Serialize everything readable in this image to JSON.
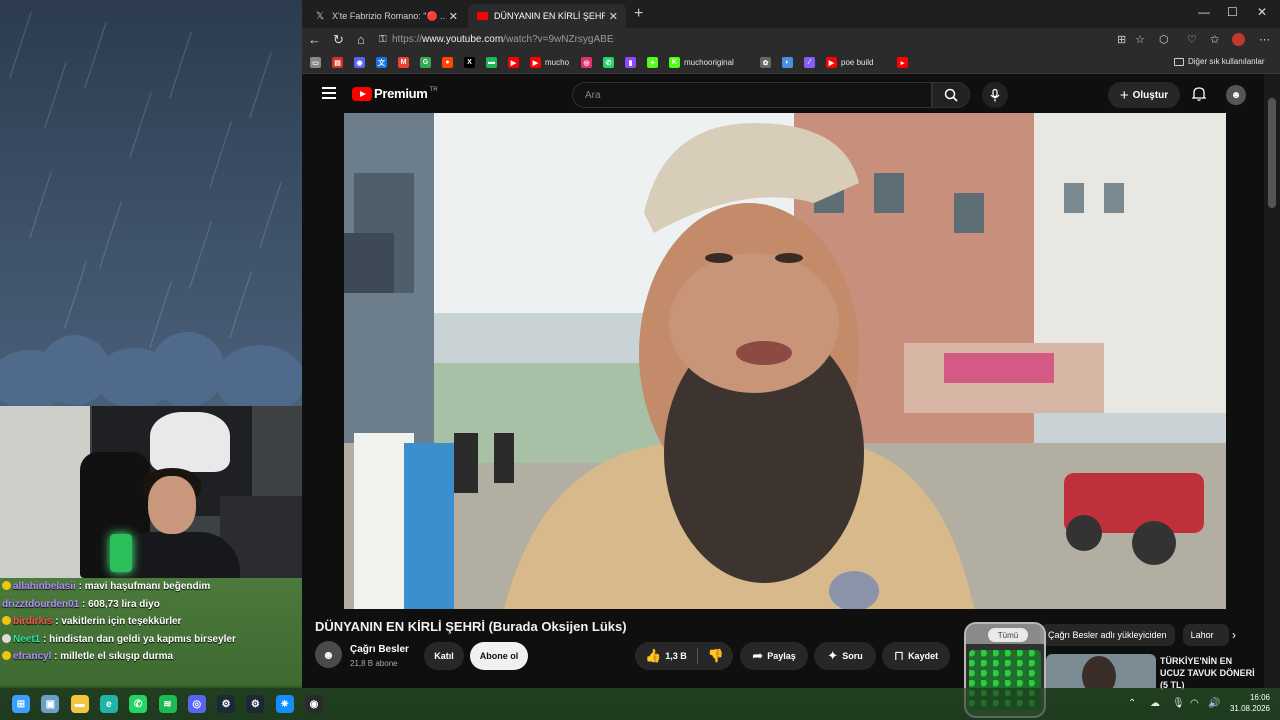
{
  "browser": {
    "tabs": [
      {
        "title": "X'te Fabrizio Romano: \"🔴 ... tk Çoru",
        "active": false,
        "icon": "x-icon"
      },
      {
        "title": "DÜNYANIN EN KİRLİ ŞEHRİ (Burada",
        "active": true,
        "icon": "youtube-icon"
      }
    ],
    "new_tab_symbol": "+",
    "url_prefix": "https://",
    "url_domain": "www.youtube.com",
    "url_path": "/watch?v=9wNZrsygABE",
    "bookmarks": [
      {
        "label": "",
        "color": "#888888",
        "glyph": "▭"
      },
      {
        "label": "",
        "color": "#d93025",
        "glyph": "▤"
      },
      {
        "label": "",
        "color": "#5865f2",
        "glyph": "◉"
      },
      {
        "label": "",
        "color": "#1a73e8",
        "glyph": "文"
      },
      {
        "label": "",
        "color": "#ea4335",
        "glyph": "M"
      },
      {
        "label": "",
        "color": "#34a853",
        "glyph": "G"
      },
      {
        "label": "",
        "color": "#ff4500",
        "glyph": "●"
      },
      {
        "label": "",
        "color": "#000000",
        "glyph": "X"
      },
      {
        "label": "",
        "color": "#1db954",
        "glyph": "▬"
      },
      {
        "label": "",
        "color": "#ff0000",
        "glyph": "▶"
      },
      {
        "label": "mucho",
        "color": "#ff0000",
        "glyph": "▶"
      },
      {
        "label": "",
        "color": "#e1306c",
        "glyph": "◎"
      },
      {
        "label": "",
        "color": "#25d366",
        "glyph": "✆"
      },
      {
        "label": "",
        "color": "#9146ff",
        "glyph": "▮"
      },
      {
        "label": "",
        "color": "#53fc18",
        "glyph": "✦"
      },
      {
        "label": "muchooriginal",
        "color": "#53fc18",
        "glyph": "K"
      },
      {
        "label": "",
        "color": "#666666",
        "glyph": "✿"
      },
      {
        "label": "",
        "color": "#4a90e2",
        "glyph": "◐"
      },
      {
        "label": "",
        "color": "#8a5cf6",
        "glyph": "⁄"
      },
      {
        "label": "poe build",
        "color": "#ff0000",
        "glyph": "▶"
      },
      {
        "label": "",
        "color": "#ff0000",
        "glyph": "▸"
      }
    ],
    "other_bookmarks": "Diğer sık kullanılanlar"
  },
  "youtube": {
    "logo_text": "Premium",
    "logo_region": "TR",
    "search_placeholder": "Ara",
    "create_label": "Oluştur",
    "video_title": "DÜNYANIN EN KİRLİ ŞEHRİ (Burada Oksijen Lüks)",
    "channel_name": "Çağrı Besler",
    "subscribers": "21,8 B abone",
    "join_label": "Katıl",
    "subscribe_label": "Abone ol",
    "likes": "1,3 B",
    "share_label": "Paylaş",
    "ask_label": "Soru",
    "save_label": "Kaydet",
    "chips": [
      "Tümü",
      "Çağrı Besler adlı yükleyiciden",
      "Lahor"
    ],
    "rec_title": "TÜRKİYE'NİN EN UCUZ TAVUK DÖNERİ (5 TL)"
  },
  "chat": [
    {
      "user": "allahinbelasii",
      "message": "mavi haşufmanı beğendim",
      "color": "#b58cff",
      "badge": "#f1c40f"
    },
    {
      "user": "drizztdourden01",
      "message": "608,73 lira diyo",
      "color": "#b58cff",
      "badge": ""
    },
    {
      "user": "birdirkis",
      "message": "vakitlerin için teşekkürler",
      "color": "#ff4f4f",
      "badge": "#f1c40f"
    },
    {
      "user": "Neet1",
      "message": "hindistan dan geldi ya kapmıs birseyler",
      "color": "#2ee6a8",
      "badge": "#dddddd"
    },
    {
      "user": "efrancyl",
      "message": "milletle el sıkışıp durma",
      "color": "#b58cff",
      "badge": "#f1c40f"
    }
  ],
  "jar_label": "Tümü",
  "taskbar": {
    "time": "16:06",
    "date": "31.08.2026",
    "apps": [
      {
        "name": "windows-start-icon",
        "color": "#3aa0ff",
        "glyph": "⊞"
      },
      {
        "name": "task-view-icon",
        "color": "#6aa0c8",
        "glyph": "▣"
      },
      {
        "name": "file-explorer-icon",
        "color": "#f5c542",
        "glyph": "▬"
      },
      {
        "name": "edge-icon",
        "color": "#1fb4a6",
        "glyph": "e"
      },
      {
        "name": "whatsapp-icon",
        "color": "#25d366",
        "glyph": "✆"
      },
      {
        "name": "spotify-icon",
        "color": "#1db954",
        "glyph": "≋"
      },
      {
        "name": "discord-icon",
        "color": "#5865f2",
        "glyph": "◎"
      },
      {
        "name": "steam-icon",
        "color": "#1b2838",
        "glyph": "⚙"
      },
      {
        "name": "steam-2-icon",
        "color": "#1b2838",
        "glyph": "⚙"
      },
      {
        "name": "battlenet-icon",
        "color": "#148eff",
        "glyph": "✷"
      },
      {
        "name": "obs-icon",
        "color": "#2a2a2a",
        "glyph": "◉"
      }
    ]
  }
}
